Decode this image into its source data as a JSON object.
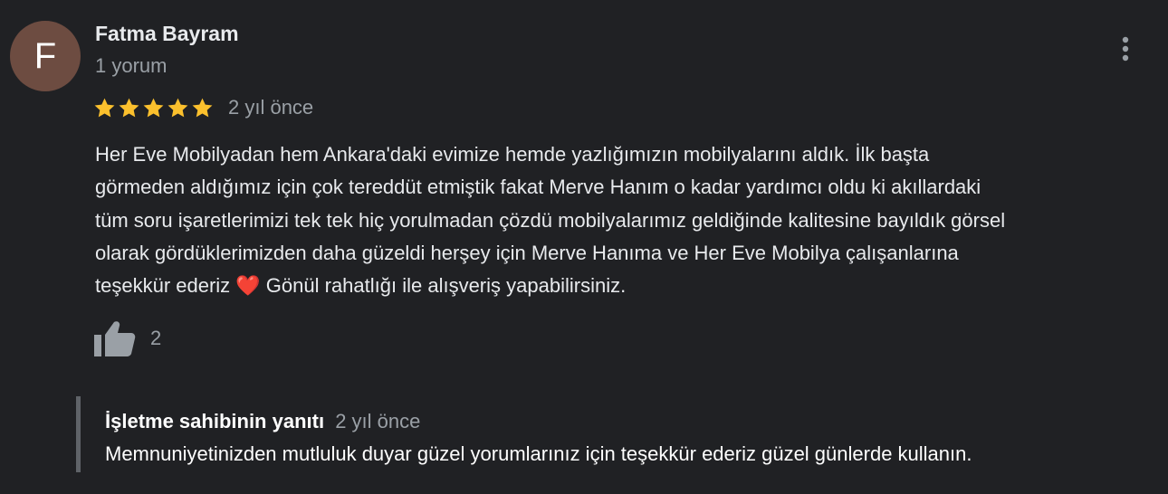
{
  "review": {
    "author": {
      "initial": "F",
      "name": "Fatma Bayram",
      "review_count": "1 yorum",
      "avatar_color": "#6d4c41"
    },
    "rating": 5,
    "rating_max": 5,
    "star_color": "#fbc02d",
    "date": "2 yıl önce",
    "text_lines": [
      "Her Eve Mobilyadan hem Ankara'daki evimize hemde yazlığımızın mobilyalarını aldık. İlk başta",
      "görmeden aldığımız için çok tereddüt etmiştik fakat Merve Hanım o kadar yardımcı oldu ki akıllardaki",
      "tüm soru işaretlerimizi tek tek hiç yorulmadan çözdü mobilyalarımız geldiğinde kalitesine bayıldık görsel",
      "olarak gördüklerimizden daha güzeldi herşey için Merve Hanıma ve Her Eve Mobilya çalışanlarına",
      "teşekkür ederiz ❤️ Gönül rahatlığı ile alışveriş yapabilirsiniz."
    ],
    "likes": "2",
    "icons": {
      "more": "more-vert-icon",
      "like": "thumb-up-icon",
      "star": "star-icon"
    }
  },
  "owner_reply": {
    "title": "İşletme sahibinin yanıtı",
    "date": "2 yıl önce",
    "text": "Memnuniyetinizden mutluluk duyar güzel yorumlarınız için teşekkür ederiz güzel günlerde kullanın."
  }
}
